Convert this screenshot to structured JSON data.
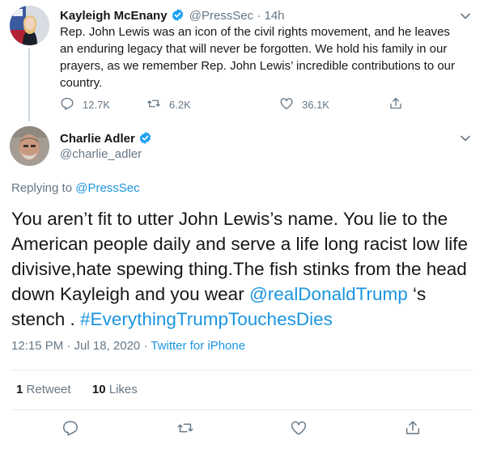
{
  "parent_tweet": {
    "author_name": "Kayleigh McEnany",
    "author_handle": "@PressSec",
    "separator": "·",
    "time_ago": "14h",
    "text": "Rep. John Lewis was an icon of the civil rights movement, and he leaves an enduring legacy that will never be forgotten. We hold his family in our prayers, as we remember Rep. John Lewis’ incredible contributions to our country.",
    "reply_count": "12.7K",
    "retweet_count": "6.2K",
    "like_count": "36.1K"
  },
  "reply_tweet": {
    "author_name": "Charlie Adler",
    "author_handle": "@charlie_adler",
    "replying_prefix": "Replying to",
    "replying_to": "@PressSec",
    "text_part1": "You aren’t fit to utter  John Lewis’s name. You lie to the American people daily and serve a life long racist low life divisive,hate spewing thing.The fish stinks from the head down Kayleigh and you wear ",
    "mention": "@realDonaldTrump",
    "text_part2": " ‘s stench . ",
    "hashtag": "#EverythingTrumpTouchesDies",
    "timestamp": "12:15 PM · Jul 18, 2020",
    "stamp_separator": "·",
    "source": "Twitter for iPhone",
    "retweets_num": "1",
    "retweets_label": "Retweet",
    "likes_num": "10",
    "likes_label": "Likes"
  },
  "colors": {
    "link": "#1b95e0",
    "verified": "#1da1f2",
    "muted": "#657786",
    "text": "#14171a",
    "divider": "#e6ecf0"
  },
  "icons": [
    "verified-badge-icon",
    "chevron-down-icon",
    "reply-icon",
    "retweet-icon",
    "like-icon",
    "share-icon"
  ]
}
